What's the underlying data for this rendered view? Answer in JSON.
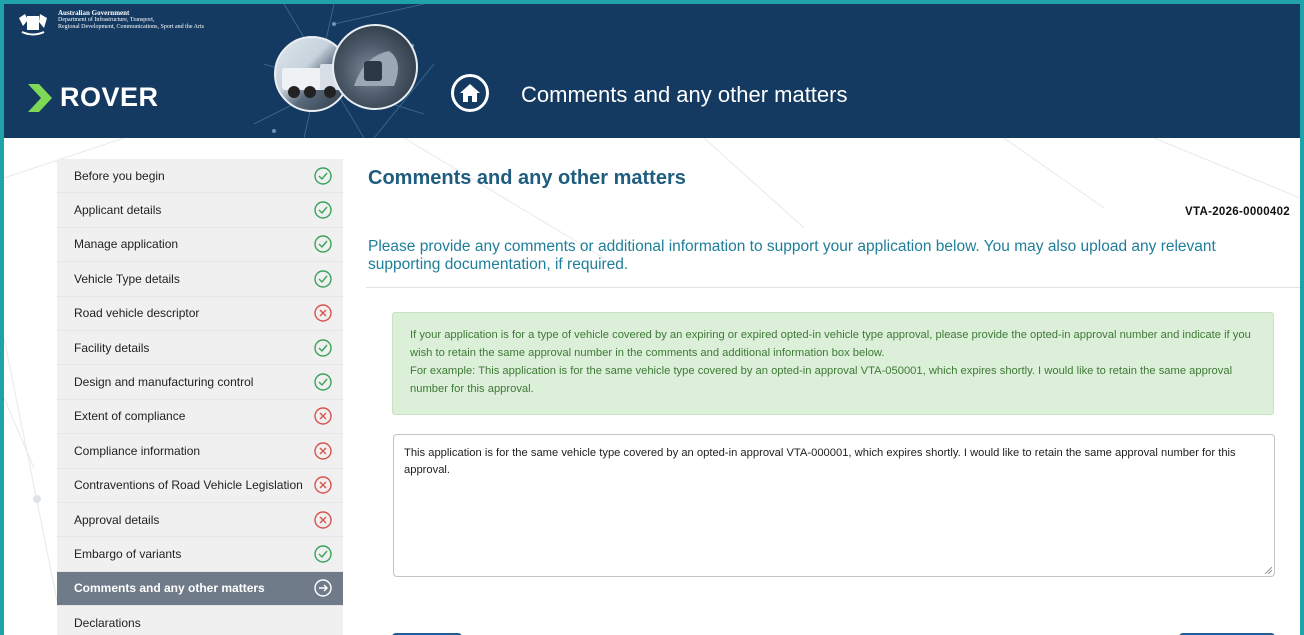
{
  "header": {
    "gov_line1": "Australian Government",
    "gov_line2": "Department of Infrastructure, Transport,",
    "gov_line3": "Regional Development, Communications, Sport and the Arts",
    "brand": "ROVER",
    "page_title": "Comments and any other matters"
  },
  "sidebar": {
    "items": [
      {
        "label": "Before you begin",
        "status": "complete"
      },
      {
        "label": "Applicant details",
        "status": "complete"
      },
      {
        "label": "Manage application",
        "status": "complete"
      },
      {
        "label": "Vehicle Type details",
        "status": "complete"
      },
      {
        "label": "Road vehicle descriptor",
        "status": "incomplete"
      },
      {
        "label": "Facility details",
        "status": "complete"
      },
      {
        "label": "Design and manufacturing control",
        "status": "complete"
      },
      {
        "label": "Extent of compliance",
        "status": "incomplete"
      },
      {
        "label": "Compliance information",
        "status": "incomplete"
      },
      {
        "label": "Contraventions of Road Vehicle Legislation",
        "status": "incomplete"
      },
      {
        "label": "Approval details",
        "status": "incomplete"
      },
      {
        "label": "Embargo of variants",
        "status": "complete"
      },
      {
        "label": "Comments and any other matters",
        "status": "current"
      },
      {
        "label": "Declarations",
        "status": "none"
      }
    ]
  },
  "main": {
    "title": "Comments and any other matters",
    "reference": "VTA-2026-0000402",
    "intro": "Please provide any comments or additional information to support your application below. You may also upload any relevant supporting documentation, if required.",
    "notice_line1": "If your application is for a type of vehicle covered by an expiring or expired opted-in vehicle type approval, please provide the opted-in approval number and indicate if you wish to retain the same approval number in the comments and additional information box below.",
    "notice_line2": "For example: This application is for the same vehicle type covered by an opted-in approval VTA-050001, which expires shortly. I would like to retain the same approval number for this approval.",
    "comment_value": "This application is for the same vehicle type covered by an opted-in approval VTA-000001, which expires shortly.  I would like to retain the same approval number for this approval."
  },
  "colors": {
    "header_bg": "#143a61",
    "frame": "#1fa3a8",
    "complete": "#3aa35a",
    "incomplete": "#d9534f",
    "active_item": "#6f7b88",
    "heading": "#1f5d80",
    "notice_bg": "#dcefd9"
  },
  "icons": {
    "complete": "check-circle-icon",
    "incomplete": "x-circle-icon",
    "current": "arrow-right-circle-icon",
    "home": "home-icon"
  }
}
